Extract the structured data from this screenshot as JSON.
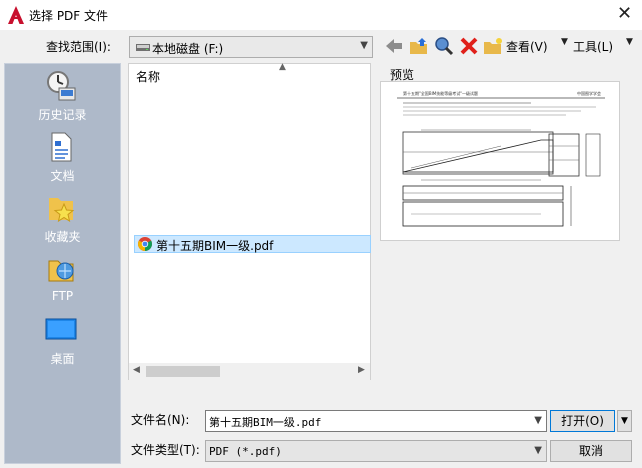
{
  "window": {
    "title": "选择 PDF 文件",
    "close_glyph": "✕",
    "logo_icon": "autocad-logo-icon"
  },
  "lookin": {
    "label": "查找范围(I):",
    "value": "本地磁盘 (F:)",
    "drive_icon": "drive-icon"
  },
  "toolbar": {
    "icons": [
      "back-icon",
      "up-folder-icon",
      "search-web-icon",
      "delete-icon",
      "new-folder-icon"
    ],
    "view_label": "查看(V)",
    "tools_label": "工具(L)"
  },
  "places": [
    {
      "label": "历史记录",
      "icon": "history-icon"
    },
    {
      "label": "文档",
      "icon": "documents-icon"
    },
    {
      "label": "收藏夹",
      "icon": "favorites-icon"
    },
    {
      "label": "FTP",
      "icon": "ftp-icon"
    },
    {
      "label": "桌面",
      "icon": "desktop-icon"
    }
  ],
  "filelist": {
    "column_header": "名称",
    "files": [
      {
        "name": "第十五期BIM一级.pdf",
        "icon": "chrome-pdf-icon",
        "selected": true
      }
    ]
  },
  "preview": {
    "label": "预览",
    "doc_title": "第十五期\"全国BIM技能等级考试\"一级试题",
    "doc_org": "中国图学学会"
  },
  "filename": {
    "label": "文件名(N):",
    "value": "第十五期BIM一级.pdf"
  },
  "filetype": {
    "label": "文件类型(T):",
    "value": "PDF (*.pdf)"
  },
  "buttons": {
    "open": "打开(O)",
    "cancel": "取消"
  },
  "colors": {
    "places_bg": "#aeb9c9",
    "selection": "#cce8ff",
    "logo_red": "#c8102e"
  }
}
